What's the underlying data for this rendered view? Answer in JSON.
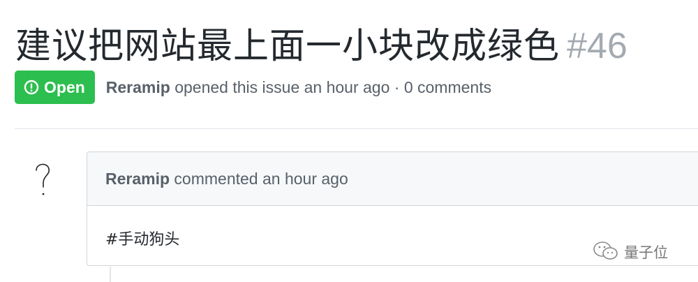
{
  "issue": {
    "title": "建议把网站最上面一小块改成绿色",
    "number": "#46",
    "status": "Open",
    "status_color": "#2cbe4e",
    "author": "Reramip",
    "meta_rest": " opened this issue an hour ago · 0 comments"
  },
  "comment": {
    "author": "Reramip",
    "header_rest": " commented an hour ago",
    "body": "#手动狗头",
    "avatar_icon": "question-mark-sketch"
  },
  "watermark": {
    "icon": "wechat-icon",
    "text": "量子位"
  }
}
